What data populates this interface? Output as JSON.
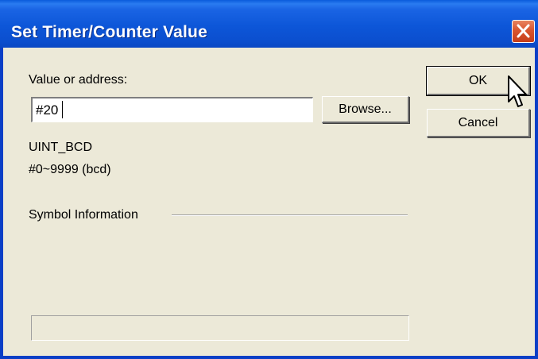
{
  "window": {
    "title": "Set Timer/Counter Value",
    "title_bar_color": "#0D56D8",
    "close_button_color": "#D9552E"
  },
  "form": {
    "value_label": "Value or address:",
    "value_input": "#20",
    "browse_label": "Browse...",
    "data_type": "UINT_BCD",
    "range": "#0~9999 (bcd)",
    "symbol_info_label": "Symbol Information",
    "symbol_info_value": ""
  },
  "buttons": {
    "ok_label": "OK",
    "cancel_label": "Cancel"
  },
  "icons": {
    "close": "close-icon",
    "cursor": "mouse-pointer-icon"
  }
}
